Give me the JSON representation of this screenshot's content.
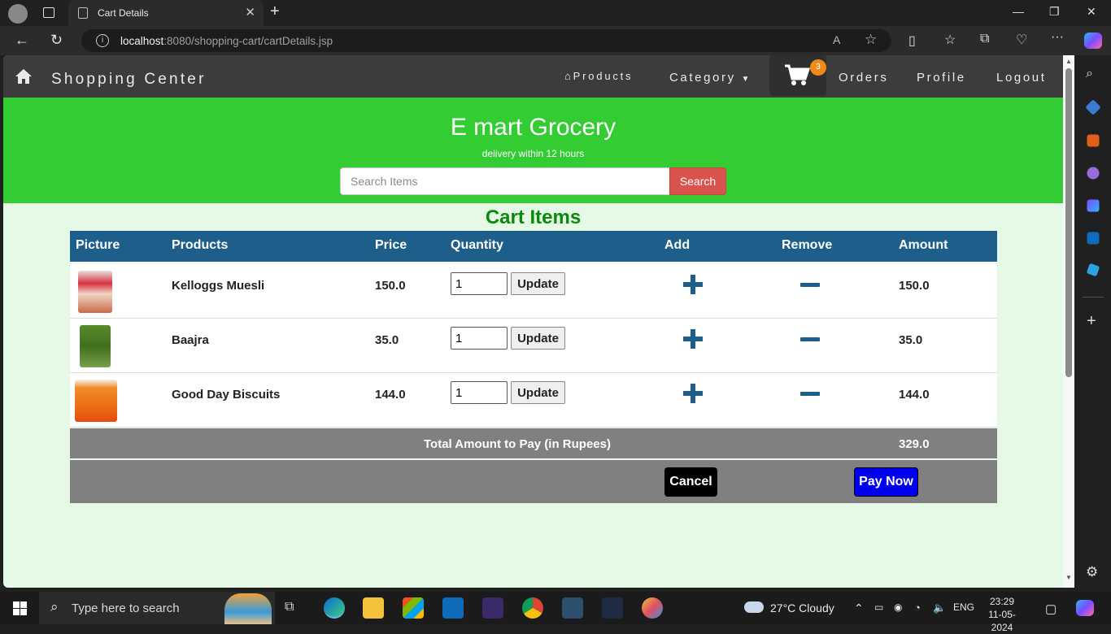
{
  "browser": {
    "tab_title": "Cart Details",
    "url_host": "localhost",
    "url_path": ":8080/shopping-cart/cartDetails.jsp"
  },
  "navbar": {
    "brand": "Shopping Center",
    "products": "Products",
    "category": "Category",
    "cart_count": "3",
    "orders": "Orders",
    "profile": "Profile",
    "logout": "Logout"
  },
  "banner": {
    "title": "E mart Grocery",
    "subtitle": "delivery within 12 hours",
    "search_placeholder": "Search Items",
    "search_button": "Search"
  },
  "cart": {
    "heading": "Cart Items",
    "columns": [
      "Picture",
      "Products",
      "Price",
      "Quantity",
      "Add",
      "Remove",
      "Amount"
    ],
    "update_label": "Update",
    "items": [
      {
        "name": "Kelloggs Muesli",
        "price": "150.0",
        "quantity": "1",
        "amount": "150.0"
      },
      {
        "name": "Baajra",
        "price": "35.0",
        "quantity": "1",
        "amount": "35.0"
      },
      {
        "name": "Good Day Biscuits",
        "price": "144.0",
        "quantity": "1",
        "amount": "144.0"
      }
    ],
    "total_label": "Total Amount to Pay (in Rupees)",
    "total_amount": "329.0",
    "cancel_label": "Cancel",
    "pay_label": "Pay Now"
  },
  "taskbar": {
    "search_placeholder": "Type here to search",
    "weather": "27°C  Cloudy",
    "lang": "ENG",
    "time": "23:29",
    "date": "11-05-2024"
  },
  "colors": {
    "navbar": "#3c3c3c",
    "banner": "#33cc33",
    "page_bg": "#e6f8e6",
    "table_header": "#1d5f8a",
    "search_button": "#d9534f",
    "pay_button": "#0000ee",
    "cart_badge": "#f08a1c",
    "heading": "#0a8a0a"
  }
}
